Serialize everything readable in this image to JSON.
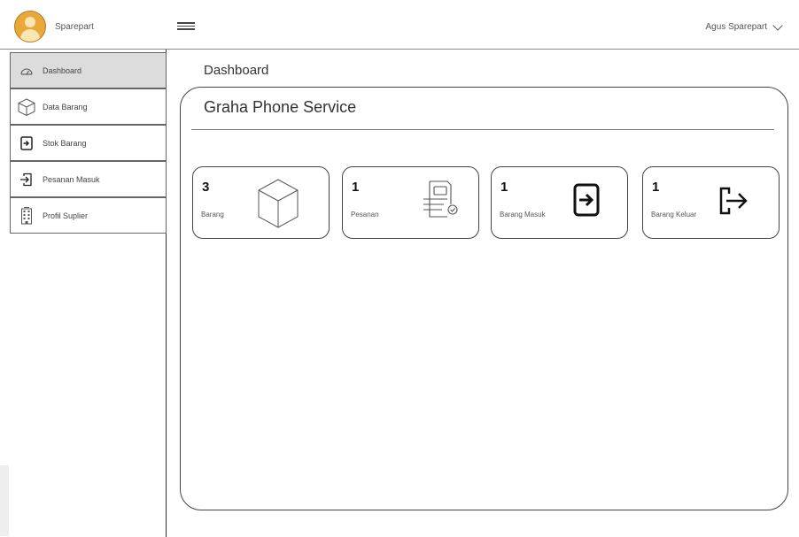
{
  "header": {
    "brand_name": "Sparepart",
    "user_name": "Agus Sparepart"
  },
  "sidebar": {
    "items": [
      {
        "label": "Dashboard",
        "icon": "dashboard-gauge-icon",
        "active": true
      },
      {
        "label": "Data Barang",
        "icon": "box-icon",
        "active": false
      },
      {
        "label": "Stok Barang",
        "icon": "stock-in-icon",
        "active": false
      },
      {
        "label": "Pesanan Masuk",
        "icon": "sign-in-arrow-icon",
        "active": false
      },
      {
        "label": "Profil Suplier",
        "icon": "building-icon",
        "active": false
      }
    ]
  },
  "main": {
    "page_title": "Dashboard",
    "panel_title": "Graha Phone Service",
    "cards": [
      {
        "count": "3",
        "label": "Barang",
        "icon": "box-icon"
      },
      {
        "count": "1",
        "label": "Pesanan",
        "icon": "order-document-icon"
      },
      {
        "count": "1",
        "label": "Barang Masuk",
        "icon": "file-import-icon"
      },
      {
        "count": "1",
        "label": "Barang Keluar",
        "icon": "exit-arrow-icon"
      }
    ]
  }
}
